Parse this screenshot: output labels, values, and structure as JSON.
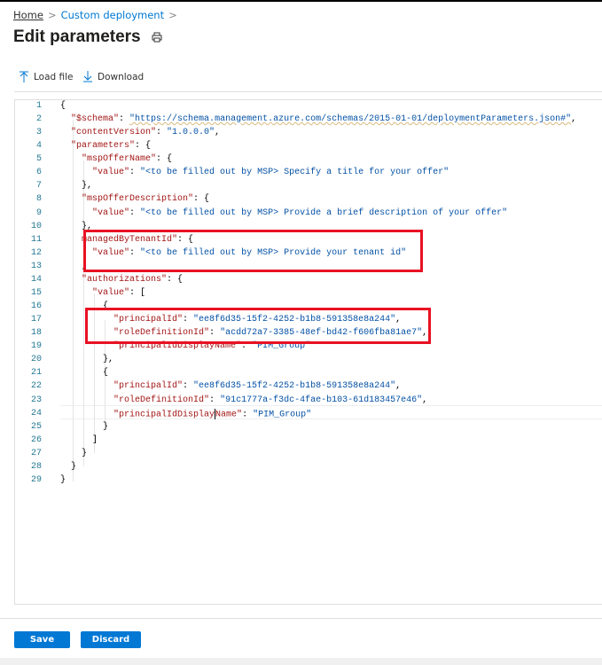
{
  "breadcrumb": {
    "home": "Home",
    "custom": "Custom deployment"
  },
  "page": {
    "title": "Edit parameters"
  },
  "toolbar": {
    "load_file": "Load file",
    "download": "Download"
  },
  "editor": {
    "line_numbers": [
      "1",
      "2",
      "3",
      "4",
      "5",
      "6",
      "7",
      "8",
      "9",
      "10",
      "11",
      "12",
      "13",
      "14",
      "15",
      "16",
      "17",
      "18",
      "19",
      "20",
      "21",
      "22",
      "23",
      "24",
      "25",
      "26",
      "27",
      "28",
      "29"
    ],
    "lines": [
      [
        [
          "p",
          "{"
        ]
      ],
      [
        [
          "p",
          "  "
        ],
        [
          "k",
          "\"$schema\""
        ],
        [
          "p",
          ": "
        ],
        [
          "su",
          "\"https://schema.management.azure.com/schemas/2015-01-01/deploymentParameters.json#\""
        ],
        [
          "p",
          ","
        ]
      ],
      [
        [
          "p",
          "  "
        ],
        [
          "k",
          "\"contentVersion\""
        ],
        [
          "p",
          ": "
        ],
        [
          "s",
          "\"1.0.0.0\""
        ],
        [
          "p",
          ","
        ]
      ],
      [
        [
          "p",
          "  "
        ],
        [
          "k",
          "\"parameters\""
        ],
        [
          "p",
          ": {"
        ]
      ],
      [
        [
          "p",
          "    "
        ],
        [
          "k",
          "\"mspOfferName\""
        ],
        [
          "p",
          ": {"
        ]
      ],
      [
        [
          "p",
          "      "
        ],
        [
          "k",
          "\"value\""
        ],
        [
          "p",
          ": "
        ],
        [
          "s",
          "\"<to be filled out by MSP> Specify a title for your offer\""
        ]
      ],
      [
        [
          "p",
          "    },"
        ]
      ],
      [
        [
          "p",
          "    "
        ],
        [
          "k",
          "\"mspOfferDescription\""
        ],
        [
          "p",
          ": {"
        ]
      ],
      [
        [
          "p",
          "      "
        ],
        [
          "k",
          "\"value\""
        ],
        [
          "p",
          ": "
        ],
        [
          "s",
          "\"<to be filled out by MSP> Provide a brief description of your offer\""
        ]
      ],
      [
        [
          "p",
          "    },"
        ]
      ],
      [
        [
          "p",
          "    "
        ],
        [
          "k",
          "managedByTenantId\""
        ],
        [
          "p",
          ": {"
        ]
      ],
      [
        [
          "p",
          "      "
        ],
        [
          "k",
          "\"value\""
        ],
        [
          "p",
          ": "
        ],
        [
          "s",
          "\"<to be filled out by MSP> Provide your tenant id\""
        ]
      ],
      [
        [
          "p",
          "    ,"
        ]
      ],
      [
        [
          "p",
          "    "
        ],
        [
          "k",
          "\"authorizations\""
        ],
        [
          "p",
          ": {"
        ]
      ],
      [
        [
          "p",
          "      "
        ],
        [
          "k",
          "\"value\""
        ],
        [
          "p",
          ": ["
        ]
      ],
      [
        [
          "p",
          "        {"
        ]
      ],
      [
        [
          "p",
          "          "
        ],
        [
          "k",
          "\"principalId\""
        ],
        [
          "p",
          ": "
        ],
        [
          "s",
          "\"ee8f6d35-15f2-4252-b1b8-591358e8a244\""
        ],
        [
          "p",
          ","
        ]
      ],
      [
        [
          "p",
          "          "
        ],
        [
          "k",
          "\"roleDefinitionId\""
        ],
        [
          "p",
          ": "
        ],
        [
          "s",
          "\"acdd72a7-3385-48ef-bd42-f606fba81ae7\""
        ],
        [
          "p",
          ","
        ]
      ],
      [
        [
          "p",
          "          "
        ],
        [
          "k",
          "\"principalIdDisplayName\""
        ],
        [
          "p",
          ": "
        ],
        [
          "s",
          "\"PIM_Group\""
        ]
      ],
      [
        [
          "p",
          "        },"
        ]
      ],
      [
        [
          "p",
          "        {"
        ]
      ],
      [
        [
          "p",
          "          "
        ],
        [
          "k",
          "\"principalId\""
        ],
        [
          "p",
          ": "
        ],
        [
          "s",
          "\"ee8f6d35-15f2-4252-b1b8-591358e8a244\""
        ],
        [
          "p",
          ","
        ]
      ],
      [
        [
          "p",
          "          "
        ],
        [
          "k",
          "\"roleDefinitionId\""
        ],
        [
          "p",
          ": "
        ],
        [
          "s",
          "\"91c1777a-f3dc-4fae-b103-61d183457e46\""
        ],
        [
          "p",
          ","
        ]
      ],
      [
        [
          "p",
          "          "
        ],
        [
          "k",
          "\"principalIdDisplay"
        ],
        [
          "c",
          ""
        ],
        [
          "k",
          "Name\""
        ],
        [
          "p",
          ": "
        ],
        [
          "s",
          "\"PIM_Group\""
        ]
      ],
      [
        [
          "p",
          "        }"
        ]
      ],
      [
        [
          "p",
          "      ]"
        ]
      ],
      [
        [
          "p",
          "    }"
        ]
      ],
      [
        [
          "p",
          "  }"
        ]
      ],
      [
        [
          "p",
          "}"
        ]
      ]
    ]
  },
  "footer": {
    "save": "Save",
    "discard": "Discard"
  }
}
